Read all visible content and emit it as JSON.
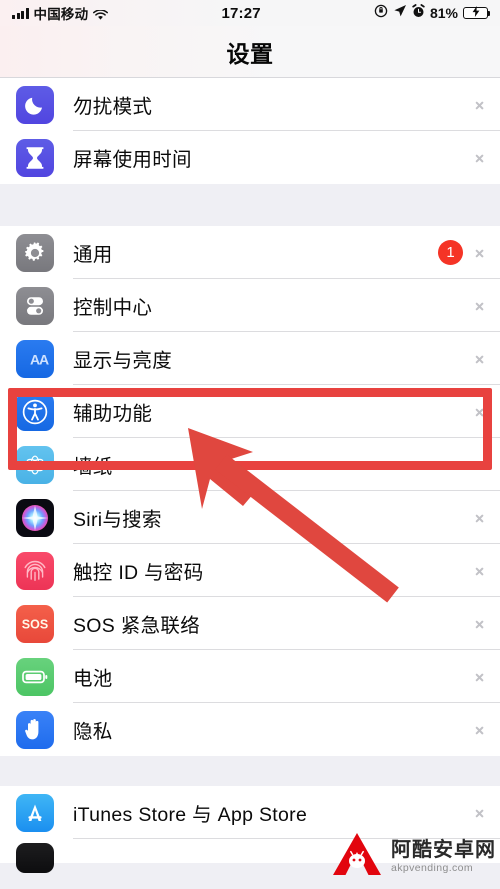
{
  "status_bar": {
    "carrier": "中国移动",
    "time": "17:27",
    "battery_percent": "81%",
    "icons": [
      "signal-bars-icon",
      "wifi-icon",
      "location-lock-icon",
      "location-arrow-icon",
      "alarm-clock-icon",
      "battery-charging-icon"
    ]
  },
  "nav": {
    "title": "设置"
  },
  "groups": [
    {
      "id": "group-focus",
      "rows": [
        {
          "label": "勿扰模式",
          "icon": "do-not-disturb-icon",
          "badge": null
        },
        {
          "label": "屏幕使用时间",
          "icon": "screen-time-icon",
          "badge": null
        }
      ]
    },
    {
      "id": "group-system",
      "rows": [
        {
          "label": "通用",
          "icon": "general-gear-icon",
          "badge": "1"
        },
        {
          "label": "控制中心",
          "icon": "control-center-icon",
          "badge": null
        },
        {
          "label": "显示与亮度",
          "icon": "display-brightness-icon",
          "badge": null
        },
        {
          "label": "辅助功能",
          "icon": "accessibility-icon",
          "badge": null
        },
        {
          "label": "墙纸",
          "icon": "wallpaper-icon",
          "badge": null
        },
        {
          "label": "Siri与搜索",
          "icon": "siri-icon",
          "badge": null
        },
        {
          "label": "触控 ID 与密码",
          "icon": "touch-id-icon",
          "badge": null
        },
        {
          "label": "SOS 紧急联络",
          "icon": "sos-icon",
          "badge": null
        },
        {
          "label": "电池",
          "icon": "battery-icon",
          "badge": null
        },
        {
          "label": "隐私",
          "icon": "privacy-hand-icon",
          "badge": null
        }
      ]
    },
    {
      "id": "group-store",
      "rows": [
        {
          "label": "iTunes Store 与 App Store",
          "icon": "app-store-icon",
          "badge": null
        }
      ]
    }
  ],
  "annotation": {
    "highlight_target": "辅助功能",
    "box_color": "#e8423f",
    "arrow_color": "#e0473f"
  },
  "watermark": {
    "name_cn": "阿酷安卓网",
    "url": "akpvending.com",
    "logo": "akp-a-logo"
  },
  "colors": {
    "accent_blue": "#1079ff",
    "badge_red": "#f53426",
    "separator": "#dcdcdf",
    "group_bg": "#efeff4"
  }
}
